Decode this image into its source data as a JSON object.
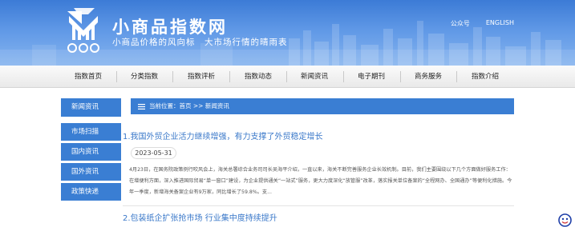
{
  "header": {
    "site_title": "小商品指数网",
    "slogan": "小商品价格的风向标　大市场行情的晴雨表",
    "links": [
      "公众号",
      "ENGLISH"
    ],
    "colors": {
      "banner_top": "#3c7bd6",
      "banner_bottom": "#86b4ef",
      "accent": "#3a7ed3",
      "link": "#3a78c9"
    }
  },
  "nav": {
    "items": [
      "指数首页",
      "分类指数",
      "指数评析",
      "指数动态",
      "新闻资讯",
      "电子期刊",
      "商务服务",
      "指数介绍"
    ]
  },
  "sidebar": {
    "heading": "新闻资讯",
    "items": [
      "市场扫描",
      "国内资讯",
      "国外资讯",
      "政策快递"
    ]
  },
  "breadcrumb": {
    "prefix": "当前位置：",
    "home": "首页",
    "separator": ">>",
    "current": "新闻资讯",
    "icon": "list-icon"
  },
  "articles": [
    {
      "title": "1.我国外贸企业活力继续增强，有力支撑了外贸稳定增长",
      "date": "2023-05-31",
      "summary": "4月23日，在国务院政策例行吹风会上，海关总署综合业务司司长吴海平介绍，一直以来，海关不断完善服务企业长效机制。目前，我们主要围绕以下几个方面做好服务工作：在增便利方面，深入推进国际贸易“单一窗口”建设，为企业提供通关“一站式”服务，更大力度深化“放管服”改革，落实报关单位备案的“全程网办、全国通办”等便利化措施。今年一季度，新增海关备案企业有9万家，同比增长了59.8%。支..."
    },
    {
      "title": "2.包装纸企扩张抢市场 行业集中度持续提升"
    }
  ],
  "floating": {
    "icon": "smiley-icon"
  }
}
